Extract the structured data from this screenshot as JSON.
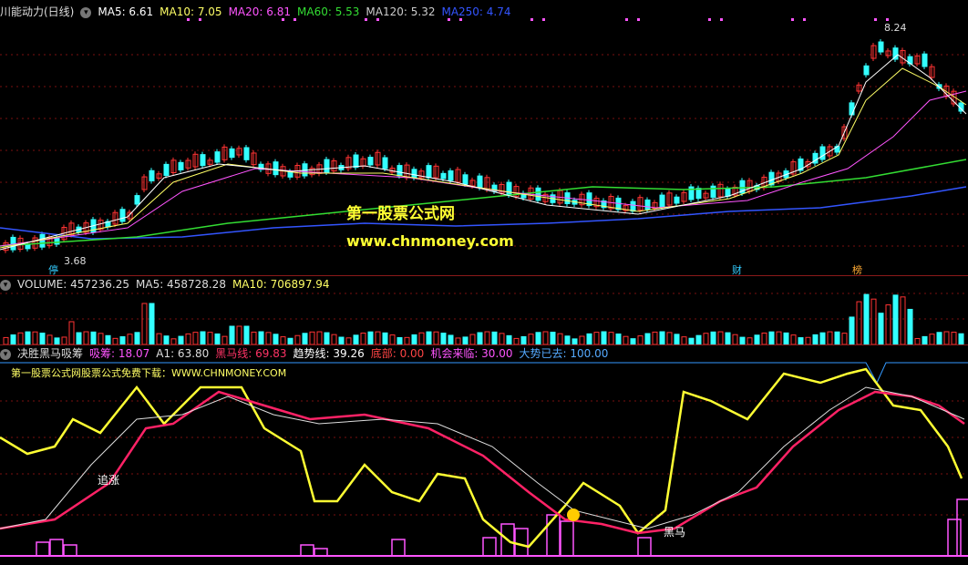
{
  "main_panel": {
    "title": "川能动力(日线)",
    "indicators": [
      {
        "label": "MA5: 6.61",
        "color": "#ffffff"
      },
      {
        "label": "MA10: 7.05",
        "color": "#ffff66"
      },
      {
        "label": "MA20: 6.81",
        "color": "#ff55ff"
      },
      {
        "label": "MA60: 5.53",
        "color": "#33dd33"
      },
      {
        "label": "MA120: 5.32",
        "color": "#cccccc"
      },
      {
        "label": "MA250: 4.74",
        "color": "#3355ff"
      }
    ],
    "high_label": "8.24",
    "low_label": "3.68",
    "markers": [
      "停",
      "财",
      "榜"
    ],
    "watermark_title": "第一股票公式网",
    "watermark_url": "www.chnmoney.com"
  },
  "volume_panel": {
    "title": "VOLUME: 457236.25",
    "ma5": "MA5: 458728.28",
    "ma10": "MA10: 706897.94"
  },
  "indicator_panel": {
    "title": "决胜黑马吸筹",
    "values": [
      {
        "label": "吸筹: 18.07",
        "color": "#ff55ff"
      },
      {
        "label": "A1: 63.80",
        "color": "#dddddd"
      },
      {
        "label": "黑马线: 69.83",
        "color": "#ff3366"
      },
      {
        "label": "趋势线: 39.26",
        "color": "#ffffff"
      },
      {
        "label": "底部: 0.00",
        "color": "#ff4444"
      },
      {
        "label": "机会来临: 30.00",
        "color": "#ff55ff"
      },
      {
        "label": "大势已去: 100.00",
        "color": "#55aaff"
      }
    ],
    "subtitle": "第一股票公式网股票公式免费下载：WWW.CHNMONEY.COM",
    "label_chase": "追涨",
    "label_black_horse": "黑马"
  },
  "colors": {
    "up": "#ff3333",
    "down": "#33ffff",
    "ma5": "#ffffff",
    "ma10": "#ffff66",
    "ma20": "#ff55ff",
    "ma60": "#33dd33",
    "ma250": "#3355ff",
    "yellow_line": "#ffff33",
    "red_line": "#ff2266"
  }
}
